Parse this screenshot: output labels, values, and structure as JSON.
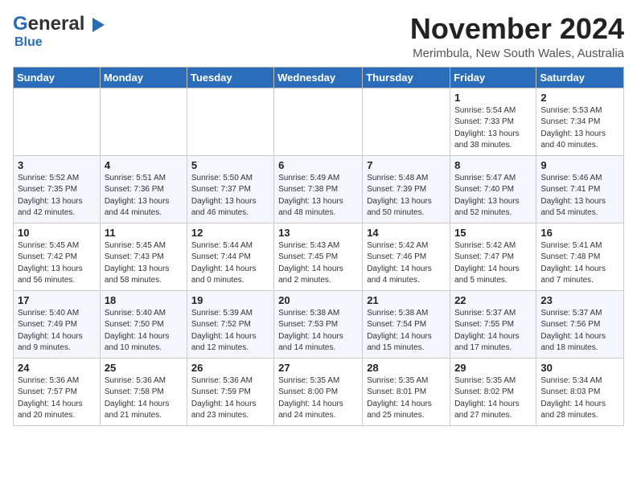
{
  "header": {
    "logo_general": "General",
    "logo_blue": "Blue",
    "month_title": "November 2024",
    "location": "Merimbula, New South Wales, Australia"
  },
  "weekdays": [
    "Sunday",
    "Monday",
    "Tuesday",
    "Wednesday",
    "Thursday",
    "Friday",
    "Saturday"
  ],
  "weeks": [
    [
      {
        "day": "",
        "info": ""
      },
      {
        "day": "",
        "info": ""
      },
      {
        "day": "",
        "info": ""
      },
      {
        "day": "",
        "info": ""
      },
      {
        "day": "",
        "info": ""
      },
      {
        "day": "1",
        "info": "Sunrise: 5:54 AM\nSunset: 7:33 PM\nDaylight: 13 hours\nand 38 minutes."
      },
      {
        "day": "2",
        "info": "Sunrise: 5:53 AM\nSunset: 7:34 PM\nDaylight: 13 hours\nand 40 minutes."
      }
    ],
    [
      {
        "day": "3",
        "info": "Sunrise: 5:52 AM\nSunset: 7:35 PM\nDaylight: 13 hours\nand 42 minutes."
      },
      {
        "day": "4",
        "info": "Sunrise: 5:51 AM\nSunset: 7:36 PM\nDaylight: 13 hours\nand 44 minutes."
      },
      {
        "day": "5",
        "info": "Sunrise: 5:50 AM\nSunset: 7:37 PM\nDaylight: 13 hours\nand 46 minutes."
      },
      {
        "day": "6",
        "info": "Sunrise: 5:49 AM\nSunset: 7:38 PM\nDaylight: 13 hours\nand 48 minutes."
      },
      {
        "day": "7",
        "info": "Sunrise: 5:48 AM\nSunset: 7:39 PM\nDaylight: 13 hours\nand 50 minutes."
      },
      {
        "day": "8",
        "info": "Sunrise: 5:47 AM\nSunset: 7:40 PM\nDaylight: 13 hours\nand 52 minutes."
      },
      {
        "day": "9",
        "info": "Sunrise: 5:46 AM\nSunset: 7:41 PM\nDaylight: 13 hours\nand 54 minutes."
      }
    ],
    [
      {
        "day": "10",
        "info": "Sunrise: 5:45 AM\nSunset: 7:42 PM\nDaylight: 13 hours\nand 56 minutes."
      },
      {
        "day": "11",
        "info": "Sunrise: 5:45 AM\nSunset: 7:43 PM\nDaylight: 13 hours\nand 58 minutes."
      },
      {
        "day": "12",
        "info": "Sunrise: 5:44 AM\nSunset: 7:44 PM\nDaylight: 14 hours\nand 0 minutes."
      },
      {
        "day": "13",
        "info": "Sunrise: 5:43 AM\nSunset: 7:45 PM\nDaylight: 14 hours\nand 2 minutes."
      },
      {
        "day": "14",
        "info": "Sunrise: 5:42 AM\nSunset: 7:46 PM\nDaylight: 14 hours\nand 4 minutes."
      },
      {
        "day": "15",
        "info": "Sunrise: 5:42 AM\nSunset: 7:47 PM\nDaylight: 14 hours\nand 5 minutes."
      },
      {
        "day": "16",
        "info": "Sunrise: 5:41 AM\nSunset: 7:48 PM\nDaylight: 14 hours\nand 7 minutes."
      }
    ],
    [
      {
        "day": "17",
        "info": "Sunrise: 5:40 AM\nSunset: 7:49 PM\nDaylight: 14 hours\nand 9 minutes."
      },
      {
        "day": "18",
        "info": "Sunrise: 5:40 AM\nSunset: 7:50 PM\nDaylight: 14 hours\nand 10 minutes."
      },
      {
        "day": "19",
        "info": "Sunrise: 5:39 AM\nSunset: 7:52 PM\nDaylight: 14 hours\nand 12 minutes."
      },
      {
        "day": "20",
        "info": "Sunrise: 5:38 AM\nSunset: 7:53 PM\nDaylight: 14 hours\nand 14 minutes."
      },
      {
        "day": "21",
        "info": "Sunrise: 5:38 AM\nSunset: 7:54 PM\nDaylight: 14 hours\nand 15 minutes."
      },
      {
        "day": "22",
        "info": "Sunrise: 5:37 AM\nSunset: 7:55 PM\nDaylight: 14 hours\nand 17 minutes."
      },
      {
        "day": "23",
        "info": "Sunrise: 5:37 AM\nSunset: 7:56 PM\nDaylight: 14 hours\nand 18 minutes."
      }
    ],
    [
      {
        "day": "24",
        "info": "Sunrise: 5:36 AM\nSunset: 7:57 PM\nDaylight: 14 hours\nand 20 minutes."
      },
      {
        "day": "25",
        "info": "Sunrise: 5:36 AM\nSunset: 7:58 PM\nDaylight: 14 hours\nand 21 minutes."
      },
      {
        "day": "26",
        "info": "Sunrise: 5:36 AM\nSunset: 7:59 PM\nDaylight: 14 hours\nand 23 minutes."
      },
      {
        "day": "27",
        "info": "Sunrise: 5:35 AM\nSunset: 8:00 PM\nDaylight: 14 hours\nand 24 minutes."
      },
      {
        "day": "28",
        "info": "Sunrise: 5:35 AM\nSunset: 8:01 PM\nDaylight: 14 hours\nand 25 minutes."
      },
      {
        "day": "29",
        "info": "Sunrise: 5:35 AM\nSunset: 8:02 PM\nDaylight: 14 hours\nand 27 minutes."
      },
      {
        "day": "30",
        "info": "Sunrise: 5:34 AM\nSunset: 8:03 PM\nDaylight: 14 hours\nand 28 minutes."
      }
    ]
  ]
}
